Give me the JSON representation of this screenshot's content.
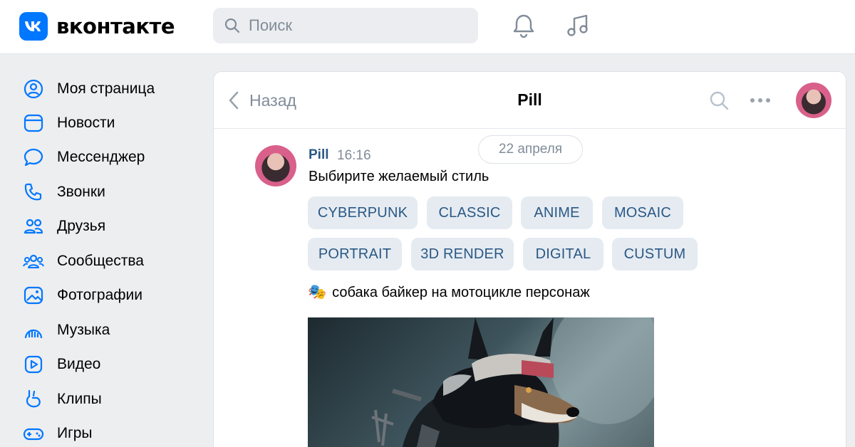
{
  "brand": {
    "name": "вконтакте",
    "logo_letter": "VK",
    "accent": "#0077ff"
  },
  "search": {
    "placeholder": "Поиск"
  },
  "header_icons": [
    "bell-icon",
    "music-note-icon"
  ],
  "sidebar": {
    "items": [
      {
        "label": "Моя страница",
        "icon": "profile-icon"
      },
      {
        "label": "Новости",
        "icon": "news-icon"
      },
      {
        "label": "Мессенджер",
        "icon": "chat-bubble-icon"
      },
      {
        "label": "Звонки",
        "icon": "phone-icon"
      },
      {
        "label": "Друзья",
        "icon": "friends-icon"
      },
      {
        "label": "Сообщества",
        "icon": "communities-icon"
      },
      {
        "label": "Фотографии",
        "icon": "photo-icon"
      },
      {
        "label": "Музыка",
        "icon": "music-icon"
      },
      {
        "label": "Видео",
        "icon": "video-icon"
      },
      {
        "label": "Клипы",
        "icon": "clips-icon"
      },
      {
        "label": "Игры",
        "icon": "gamepad-icon"
      }
    ]
  },
  "chat": {
    "back_label": "Назад",
    "title": "Pill",
    "date": "22 апреля",
    "message": {
      "author": "Pill",
      "time": "16:16",
      "text": "Выбирите желаемый стиль",
      "buttons": [
        [
          "CYBERPUNK",
          "CLASSIC",
          "ANIME",
          "MOSAIC"
        ],
        [
          "PORTRAIT",
          "3D RENDER",
          "DIGITAL",
          "CUSTUM"
        ]
      ]
    },
    "prompt": {
      "emoji": "🎭",
      "text": "собака байкер на мотоцикле персонаж"
    }
  }
}
